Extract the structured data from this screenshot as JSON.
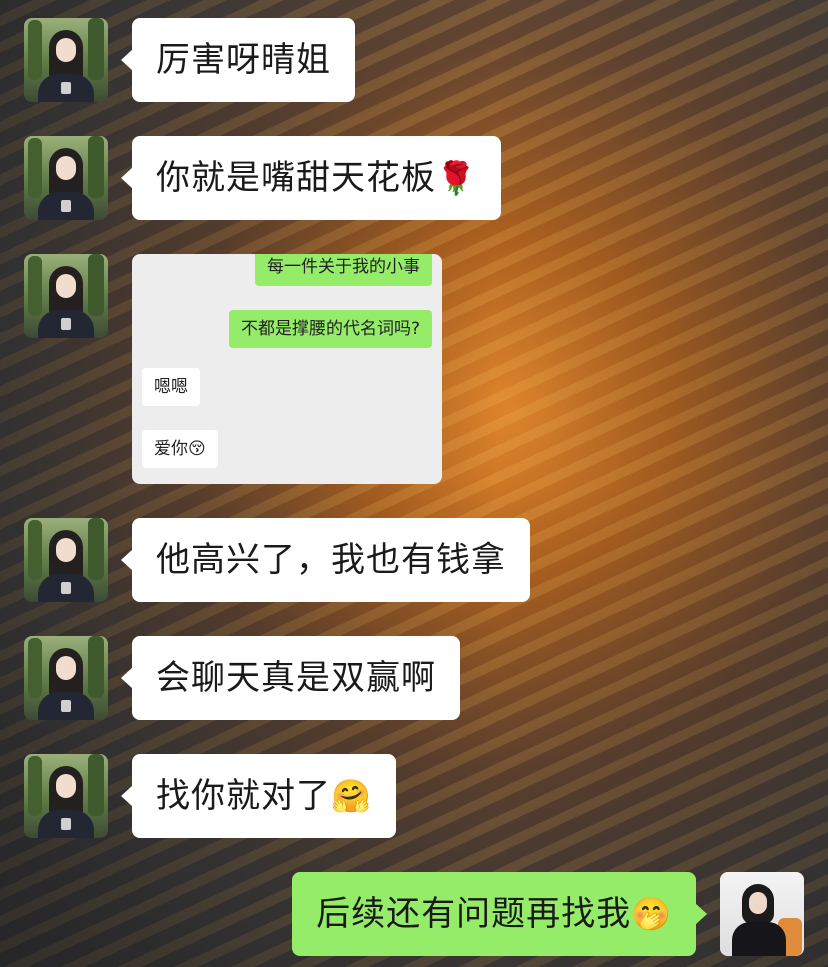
{
  "messages": [
    {
      "side": "left",
      "text": "厉害呀晴姐"
    },
    {
      "side": "left",
      "text": "你就是嘴甜天花板",
      "emoji": "🌹"
    },
    {
      "side": "left",
      "type": "screenshot"
    },
    {
      "side": "left",
      "text": "他高兴了，我也有钱拿"
    },
    {
      "side": "left",
      "text": "会聊天真是双赢啊"
    },
    {
      "side": "left",
      "text": "找你就对了",
      "emoji": "🤗"
    },
    {
      "side": "right",
      "text": "后续还有问题再找我",
      "emoji": "🤭"
    }
  ],
  "screenshot": {
    "messages": [
      {
        "side": "right",
        "text": "每一件关于我的小事"
      },
      {
        "side": "right",
        "text": "不都是撑腰的代名词吗?"
      },
      {
        "side": "left",
        "text": "嗯嗯"
      },
      {
        "side": "left",
        "text": "爱你",
        "emoji": "😚"
      }
    ]
  },
  "colors": {
    "bubble_received": "#ffffff",
    "bubble_sent": "#95ec69",
    "screenshot_bg": "#ededed"
  }
}
